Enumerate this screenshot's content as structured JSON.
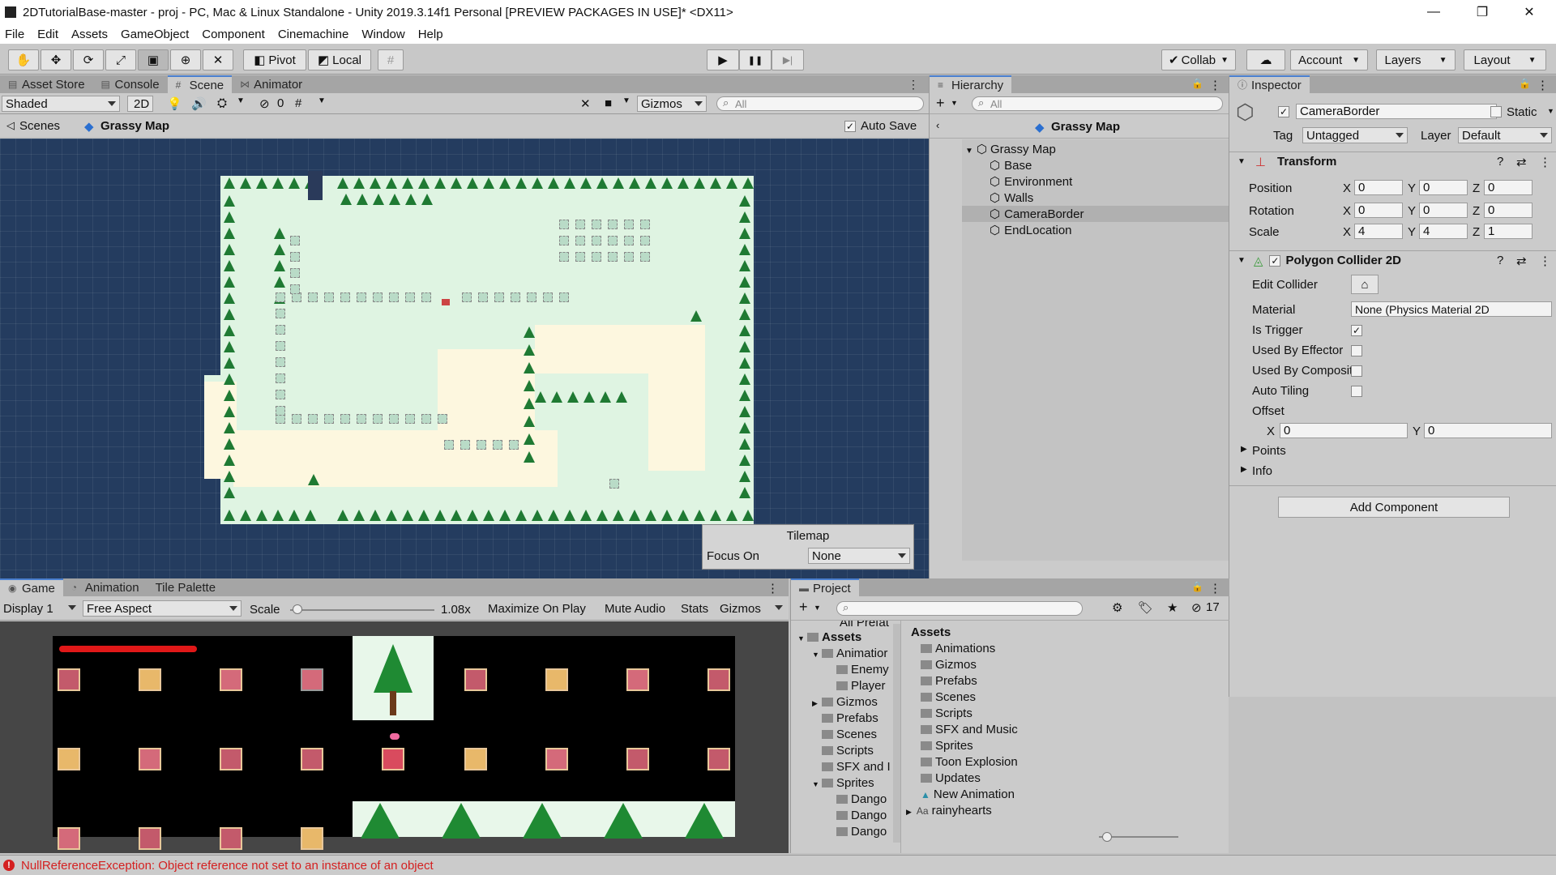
{
  "window": {
    "title": "2DTutorialBase-master - proj - PC, Mac & Linux Standalone - Unity 2019.3.14f1 Personal [PREVIEW PACKAGES IN USE]* <DX11>",
    "controls": {
      "minimize": "—",
      "maximize": "❐",
      "close": "✕"
    }
  },
  "menu": [
    "File",
    "Edit",
    "Assets",
    "GameObject",
    "Component",
    "Cinemachine",
    "Window",
    "Help"
  ],
  "toolbar": {
    "pivot_label": "Pivot",
    "local_label": "Local",
    "collab_label": "Collab",
    "account_label": "Account",
    "layers_label": "Layers",
    "layout_label": "Layout",
    "play_icon": "▶",
    "pause_icon": "❚❚",
    "step_icon": "▶|"
  },
  "scene_panel": {
    "tabs": [
      "Asset Store",
      "Console",
      "Scene",
      "Animator"
    ],
    "active_tab": "Scene",
    "shading": "Shaded",
    "mode_2d": "2D",
    "hidden_count": "0",
    "gizmos": "Gizmos",
    "search_placeholder": "All",
    "breadcrumb_root": "Scenes",
    "breadcrumb_scene": "Grassy Map",
    "auto_save": "Auto Save",
    "tilemap_overlay": {
      "title": "Tilemap",
      "focus_label": "Focus On",
      "focus_value": "None"
    }
  },
  "hierarchy": {
    "title": "Hierarchy",
    "search_placeholder": "All",
    "scene_name": "Grassy Map",
    "root": "Grassy Map",
    "children": [
      "Base",
      "Environment",
      "Walls",
      "CameraBorder",
      "EndLocation"
    ],
    "selected": "CameraBorder"
  },
  "inspector": {
    "title": "Inspector",
    "object_name": "CameraBorder",
    "static_label": "Static",
    "tag_label": "Tag",
    "tag_value": "Untagged",
    "layer_label": "Layer",
    "layer_value": "Default",
    "transform": {
      "title": "Transform",
      "position_label": "Position",
      "rotation_label": "Rotation",
      "scale_label": "Scale",
      "axis_x": "X",
      "axis_y": "Y",
      "axis_z": "Z",
      "position": [
        "0",
        "0",
        "0"
      ],
      "rotation": [
        "0",
        "0",
        "0"
      ],
      "scale": [
        "4",
        "4",
        "1"
      ]
    },
    "collider": {
      "title": "Polygon Collider 2D",
      "edit_collider": "Edit Collider",
      "material_label": "Material",
      "material_value": "None (Physics Material 2D",
      "is_trigger": "Is Trigger",
      "used_by_effector": "Used By Effector",
      "used_by_composite": "Used By Composite",
      "auto_tiling": "Auto Tiling",
      "offset": "Offset",
      "offset_x": "0",
      "offset_y": "0",
      "points": "Points",
      "info": "Info"
    },
    "add_component": "Add Component"
  },
  "game_panel": {
    "tabs": [
      "Game",
      "Animation",
      "Tile Palette"
    ],
    "active_tab": "Game",
    "display": "Display 1",
    "aspect": "Free Aspect",
    "scale_label": "Scale",
    "scale_value": "1.08x",
    "scale_fraction": 0.05,
    "maximize": "Maximize On Play",
    "mute": "Mute Audio",
    "stats": "Stats",
    "gizmos": "Gizmos"
  },
  "project": {
    "title": "Project",
    "hidden_count": "17",
    "tree_partial_top": "All Prefat",
    "tree": [
      {
        "label": "Assets",
        "depth": 0,
        "bold": true,
        "open": true
      },
      {
        "label": "Animatior",
        "depth": 1,
        "open": true
      },
      {
        "label": "Enemy",
        "depth": 2
      },
      {
        "label": "Player",
        "depth": 2
      },
      {
        "label": "Gizmos",
        "depth": 1,
        "closed": true
      },
      {
        "label": "Prefabs",
        "depth": 1
      },
      {
        "label": "Scenes",
        "depth": 1
      },
      {
        "label": "Scripts",
        "depth": 1
      },
      {
        "label": "SFX and I",
        "depth": 1
      },
      {
        "label": "Sprites",
        "depth": 1,
        "open": true
      },
      {
        "label": "Dango",
        "depth": 2
      },
      {
        "label": "Dango",
        "depth": 2
      },
      {
        "label": "Dango",
        "depth": 2
      }
    ],
    "assets_header": "Assets",
    "assets": [
      "Animations",
      "Gizmos",
      "Prefabs",
      "Scenes",
      "Scripts",
      "SFX and Music",
      "Sprites",
      "Toon Explosion",
      "Updates",
      "New Animation",
      "rainyhearts"
    ]
  },
  "status": {
    "message": "NullReferenceException: Object reference not set to an instance of an object",
    "color": "#d42020"
  }
}
